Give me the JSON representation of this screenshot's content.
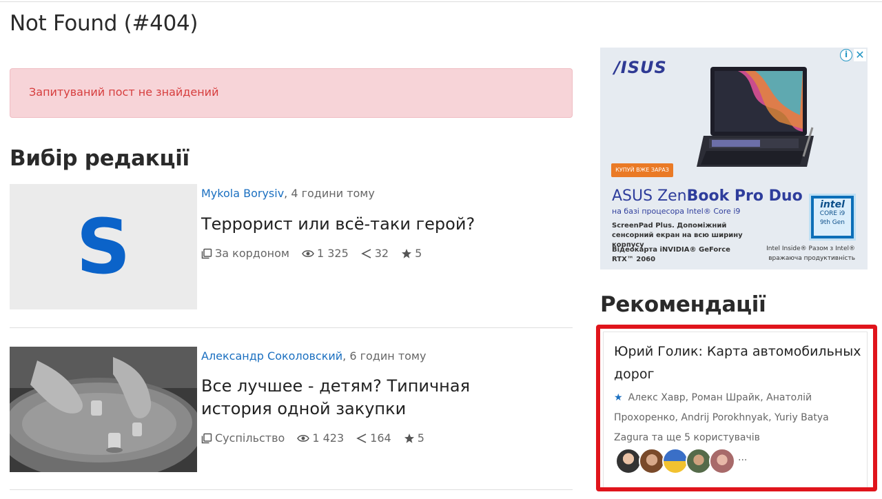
{
  "page": {
    "title": "Not Found (#404)",
    "alert": "Запитуваний пост не знайдений"
  },
  "editors_choice": {
    "title": "Вибір редакції",
    "articles": [
      {
        "author": "Mykola Borysiv",
        "time": ", 4 години тому",
        "headline": "Террорист или всё-таки герой?",
        "category": "За кордоном",
        "views": "1 325",
        "shares": "32",
        "stars": "5",
        "thumb_letter": "S"
      },
      {
        "author": "Александр Соколовский",
        "time": ", 6 годин тому",
        "headline": "Все лучшее - детям? Типичная история одной закупки",
        "category": "Суспільство",
        "views": "1 423",
        "shares": "164",
        "stars": "5"
      }
    ]
  },
  "ad": {
    "brand": "/ISUS",
    "cta": "КУПУЙ ВЖЕ ЗАРАЗ",
    "product_light": "ASUS Zen",
    "product_bold": "Book Pro Duo",
    "processor": "на базі процесора Intel® Core i9",
    "desc1": "ScreenPad Plus. Допоміжний сенсорний екран на всю ширину корпусу",
    "desc2": "Відеокарта iNVIDIA® GeForce RTX™ 2060",
    "intel_logo": "intel",
    "intel_core": "CORE i9",
    "intel_gen": "9th Gen",
    "intel_note": "Intel Inside® Разом з Intel® вражаюча продуктивність",
    "info_symbol": "i",
    "close_symbol": "✕"
  },
  "recommendations": {
    "title": "Рекомендації",
    "item": {
      "headline": "Юрий Голик: Карта автомобильных дорог",
      "star": "★",
      "users": "Алекс Хавр, Роман Шрайк, Анатолій Прохоренко, Andrij Porokhnyak, Yuriy Batya Zagura та ще 5 користувачів",
      "more": "..."
    }
  },
  "colors": {
    "link": "#1a6fc0",
    "alert_bg": "#f7d4d8",
    "alert_text": "#d63d3d",
    "highlight": "#e0141b"
  },
  "icons": {
    "category": "category-icon",
    "views": "eye-icon",
    "shares": "share-icon",
    "stars": "star-icon"
  }
}
